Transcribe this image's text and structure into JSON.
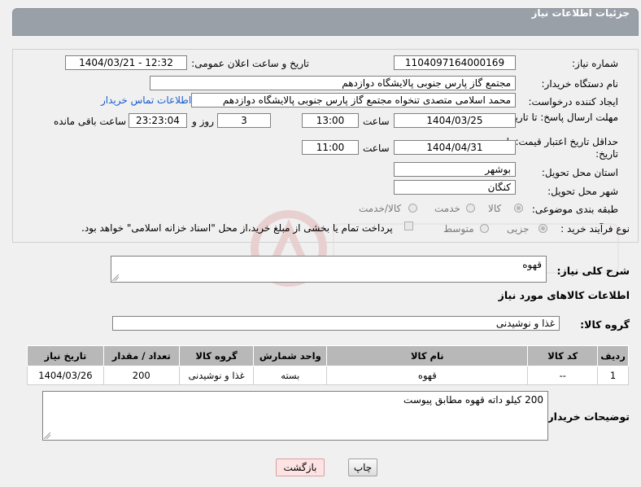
{
  "header": {
    "title": "جزئیات اطلاعات نیاز"
  },
  "form": {
    "need_number_label": "شماره نیاز:",
    "need_number": "1104097164000169",
    "announce_label": "تاریخ و ساعت اعلان عمومی:",
    "announce_value": "1404/03/21 - 12:32",
    "buyer_org_label": "نام دستگاه خریدار:",
    "buyer_org": "مجتمع گاز پارس جنوبی  پالایشگاه دوازدهم",
    "creator_label": "ایجاد کننده درخواست:",
    "creator": "محمد اسلامی متصدی تنخواه مجتمع گاز پارس جنوبی  پالایشگاه دوازدهم",
    "contact_link": "اطلاعات تماس خریدار",
    "deadline_label": "مهلت ارسال پاسخ: تا تاریخ:",
    "deadline_date": "1404/03/25",
    "time_label": "ساعت",
    "deadline_time": "13:00",
    "days_value": "3",
    "days_and_label": "روز و",
    "remaining_time": "23:23:04",
    "remaining_label": "ساعت باقی مانده",
    "validity_label": "حداقل تاریخ اعتبار قیمت: تا تاریخ:",
    "validity_date": "1404/04/31",
    "validity_time": "11:00",
    "province_label": "استان محل تحویل:",
    "province": "بوشهر",
    "city_label": "شهر محل تحویل:",
    "city": "کنگان",
    "category_label": "طبقه بندی موضوعی:",
    "category_options": [
      "کالا",
      "خدمت",
      "کالا/خدمت"
    ],
    "process_label": "نوع فرآیند خرید :",
    "process_options": [
      "جزیی",
      "متوسط"
    ],
    "payment_note": "پرداخت تمام یا بخشی از مبلغ خرید،از محل \"اسناد خزانه اسلامی\" خواهد بود."
  },
  "summary": {
    "label": "شرح کلی نیاز:",
    "value": "قهوه"
  },
  "goods": {
    "section_title": "اطلاعات کالاهای مورد نیاز",
    "group_label": "گروه کالا:",
    "group_value": "غذا و نوشیدنی",
    "columns": [
      "ردیف",
      "کد کالا",
      "نام کالا",
      "واحد شمارش",
      "گروه کالا",
      "تعداد / مقدار",
      "تاریخ نیاز"
    ],
    "rows": [
      [
        "1",
        "--",
        "قهوه",
        "بسته",
        "غذا و نوشیدنی",
        "200",
        "1404/03/26"
      ]
    ]
  },
  "buyer_notes": {
    "label": "توضیحات خریدار:",
    "value": "200 کیلو داته قهوه مطابق پیوست"
  },
  "buttons": {
    "print": "چاپ",
    "back": "بازگشت"
  }
}
